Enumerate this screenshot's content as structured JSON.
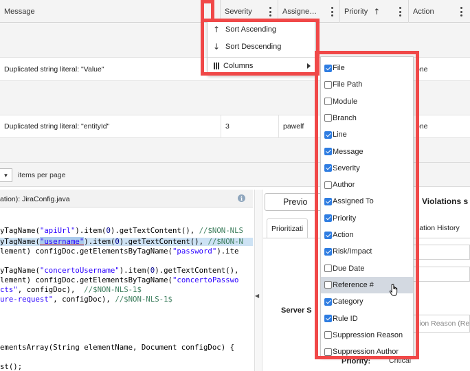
{
  "grid": {
    "headers": {
      "message": "Message",
      "severity": "Severity",
      "assigned": "Assigne…",
      "priority": "Priority",
      "priority_sort_icon": "arrow-up-icon",
      "action": "Action"
    },
    "rows": [
      {
        "message": "Duplicated string literal: \"Value\"",
        "action": "one"
      },
      {
        "message": "Duplicated string literal: \"entityId\"",
        "severity": "3",
        "assigned": "pawelf",
        "action": "one"
      }
    ]
  },
  "pager": {
    "select_icon": "chevron-down-icon",
    "label": "items per page"
  },
  "column_menu": {
    "sort_ascending": "Sort Ascending",
    "sort_descending": "Sort Descending",
    "columns": "Columns",
    "icons": {
      "ascending": "arrow-up-icon",
      "descending": "arrow-down-icon",
      "columns": "columns-icon",
      "submenu": "chevron-right-icon"
    }
  },
  "columns_submenu": {
    "items": [
      {
        "label": "File",
        "checked": true
      },
      {
        "label": "File Path",
        "checked": false
      },
      {
        "label": "Module",
        "checked": false
      },
      {
        "label": "Branch",
        "checked": false
      },
      {
        "label": "Line",
        "checked": true
      },
      {
        "label": "Message",
        "checked": true
      },
      {
        "label": "Severity",
        "checked": true
      },
      {
        "label": "Author",
        "checked": false
      },
      {
        "label": "Assigned To",
        "checked": true
      },
      {
        "label": "Priority",
        "checked": true
      },
      {
        "label": "Action",
        "checked": true
      },
      {
        "label": "Risk/Impact",
        "checked": true
      },
      {
        "label": "Due Date",
        "checked": false
      },
      {
        "label": "Reference #",
        "checked": false,
        "hover": true
      },
      {
        "label": "Category",
        "checked": true
      },
      {
        "label": "Rule ID",
        "checked": true
      },
      {
        "label": "Suppression Reason",
        "checked": false
      },
      {
        "label": "Suppression Author",
        "checked": false
      }
    ]
  },
  "editor": {
    "title": "ation): JiraConfig.java",
    "info_icon": "info-icon",
    "lines": [
      "yTagName(\"apiUrl\").item(0).getTextContent(), //$NON-NLS",
      "yTagName(\"username\").item(0).getTextContent(), //$NON-N",
      "lement) configDoc.getElementsByTagName(\"password\").ite",
      "",
      "yTagName(\"concertoUsername\").item(0).getTextContent(),",
      "lement) configDoc.getElementsByTagName(\"concertoPasswo",
      "cts\", configDoc),  //$NON-NLS-1$",
      "ure-request\", configDoc), //$NON-NLS-1$",
      "",
      "",
      "",
      "",
      "ementsArray(String elementName, Document configDoc) {",
      "",
      "st();"
    ]
  },
  "right_panel": {
    "previous_button": "Previo",
    "title": "Violations s",
    "tabs": {
      "prioritization": "Prioritizati",
      "history": "lation History"
    },
    "server_label": "Server S",
    "suppression_placeholder": "sion Reason (Re",
    "priority_label": "Priority:",
    "priority_value": "Critical"
  },
  "colors": {
    "highlight": "#f04848",
    "checkbox": "#2f7de1",
    "selection": "#aacbec"
  }
}
